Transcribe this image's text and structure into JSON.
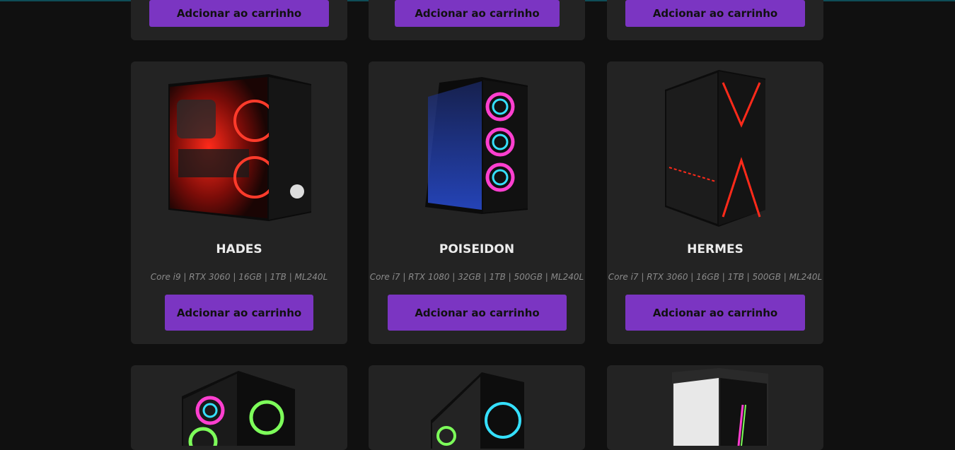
{
  "products": [
    {
      "name": "",
      "specs": "",
      "button": "Adcionar ao carrinho"
    },
    {
      "name": "",
      "specs": "",
      "button": "Adcionar ao carrinho"
    },
    {
      "name": "",
      "specs": "",
      "button": "Adcionar ao carrinho"
    },
    {
      "name": "HADES",
      "specs": "Core i9 | RTX 3060 | 16GB | 1TB | ML240L",
      "button": "Adcionar ao carrinho"
    },
    {
      "name": "POISEIDON",
      "specs": "Core i7 | RTX 1080 | 32GB | 1TB | 500GB | ML240L",
      "button": "Adcionar ao carrinho"
    },
    {
      "name": "HERMES",
      "specs": "Core i7 | RTX 3060 | 16GB | 1TB | 500GB | ML240L",
      "button": "Adcionar ao carrinho"
    }
  ],
  "colors": {
    "background": "#101010",
    "card": "#232323",
    "button": "#7b35c2",
    "title": "#ececec",
    "specs": "#8a8a8a"
  },
  "icons": [
    "pc-case-red-icon",
    "pc-case-rgb-fans-icon",
    "pc-case-x-light-icon",
    "pc-case-rgb-icon",
    "pc-case-mesh-icon",
    "pc-case-white-strip-icon"
  ]
}
